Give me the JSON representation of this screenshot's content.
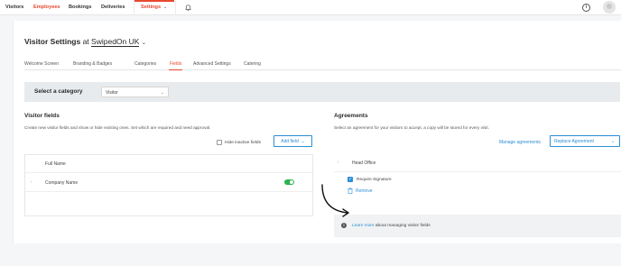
{
  "nav": {
    "items": [
      "Visitors",
      "Employees",
      "Bookings",
      "Deliveries",
      "Settings"
    ],
    "active": "Settings",
    "colors": {
      "accent": "#e8472f",
      "link": "#2b8fd6",
      "toggle_on": "#2bb34c"
    },
    "icons": [
      "bell-icon",
      "info-icon",
      "avatar"
    ]
  },
  "page": {
    "title": "Visitor Settings",
    "at": "at",
    "org": "SwipedOn UK"
  },
  "tabs": [
    "Welcome Screen",
    "Branding & Badges",
    "Categories",
    "Fields",
    "Advanced Settings",
    "Catering"
  ],
  "active_tab": "Fields",
  "category": {
    "label": "Select a category",
    "selected": "Visitor"
  },
  "visitor_fields": {
    "title": "Visitor fields",
    "description": "Create new visitor fields and show or hide existing ones. Set which are required and need approval.",
    "hide_inactive_label": "Hide inactive fields",
    "add_field_label": "Add field",
    "fields": [
      {
        "name": "Full Name",
        "toggle": false
      },
      {
        "name": "Company Name",
        "toggle": true
      }
    ]
  },
  "agreements": {
    "title": "Agreements",
    "description": "Select an agreement for your visitors to accept, a copy will be stored for every visit.",
    "manage_label": "Manage agreements",
    "replace_label": "Replace Agreement",
    "item_name": "Head Office",
    "require_signature_label": "Require Signature",
    "require_signature_checked": true,
    "remove_label": "Remove"
  },
  "info": {
    "link_text": "Learn more",
    "rest_text": "about managing visitor fields"
  }
}
